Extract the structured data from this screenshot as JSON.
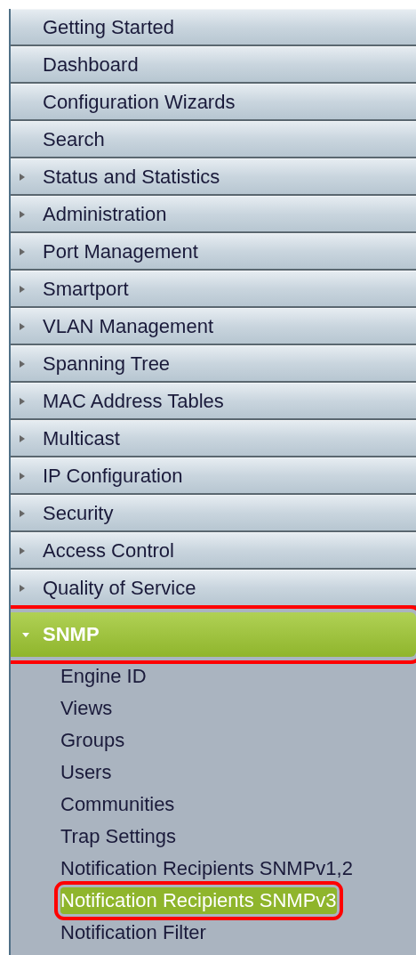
{
  "menu": [
    {
      "label": "Getting Started",
      "kind": "link"
    },
    {
      "label": "Dashboard",
      "kind": "link"
    },
    {
      "label": "Configuration Wizards",
      "kind": "link"
    },
    {
      "label": "Search",
      "kind": "link"
    },
    {
      "label": "Status and Statistics",
      "kind": "folder",
      "expanded": false,
      "highlighted": false
    },
    {
      "label": "Administration",
      "kind": "folder",
      "expanded": false,
      "highlighted": false
    },
    {
      "label": "Port Management",
      "kind": "folder",
      "expanded": false,
      "highlighted": false
    },
    {
      "label": "Smartport",
      "kind": "folder",
      "expanded": false,
      "highlighted": false
    },
    {
      "label": "VLAN Management",
      "kind": "folder",
      "expanded": false,
      "highlighted": false
    },
    {
      "label": "Spanning Tree",
      "kind": "folder",
      "expanded": false,
      "highlighted": false
    },
    {
      "label": "MAC Address Tables",
      "kind": "folder",
      "expanded": false,
      "highlighted": false
    },
    {
      "label": "Multicast",
      "kind": "folder",
      "expanded": false,
      "highlighted": false
    },
    {
      "label": "IP Configuration",
      "kind": "folder",
      "expanded": false,
      "highlighted": false
    },
    {
      "label": "Security",
      "kind": "folder",
      "expanded": false,
      "highlighted": false
    },
    {
      "label": "Access Control",
      "kind": "folder",
      "expanded": false,
      "highlighted": false
    },
    {
      "label": "Quality of Service",
      "kind": "folder",
      "expanded": false,
      "highlighted": false
    },
    {
      "label": "SNMP",
      "kind": "folder",
      "expanded": true,
      "highlighted": true,
      "children": [
        {
          "label": "Engine ID",
          "selected": false,
          "highlighted": false
        },
        {
          "label": "Views",
          "selected": false,
          "highlighted": false
        },
        {
          "label": "Groups",
          "selected": false,
          "highlighted": false
        },
        {
          "label": "Users",
          "selected": false,
          "highlighted": false
        },
        {
          "label": "Communities",
          "selected": false,
          "highlighted": false
        },
        {
          "label": "Trap Settings",
          "selected": false,
          "highlighted": false
        },
        {
          "label": "Notification Recipients SNMPv1,2",
          "selected": false,
          "highlighted": false
        },
        {
          "label": "Notification Recipients SNMPv3",
          "selected": true,
          "highlighted": true
        },
        {
          "label": "Notification Filter",
          "selected": false,
          "highlighted": false
        }
      ]
    }
  ]
}
